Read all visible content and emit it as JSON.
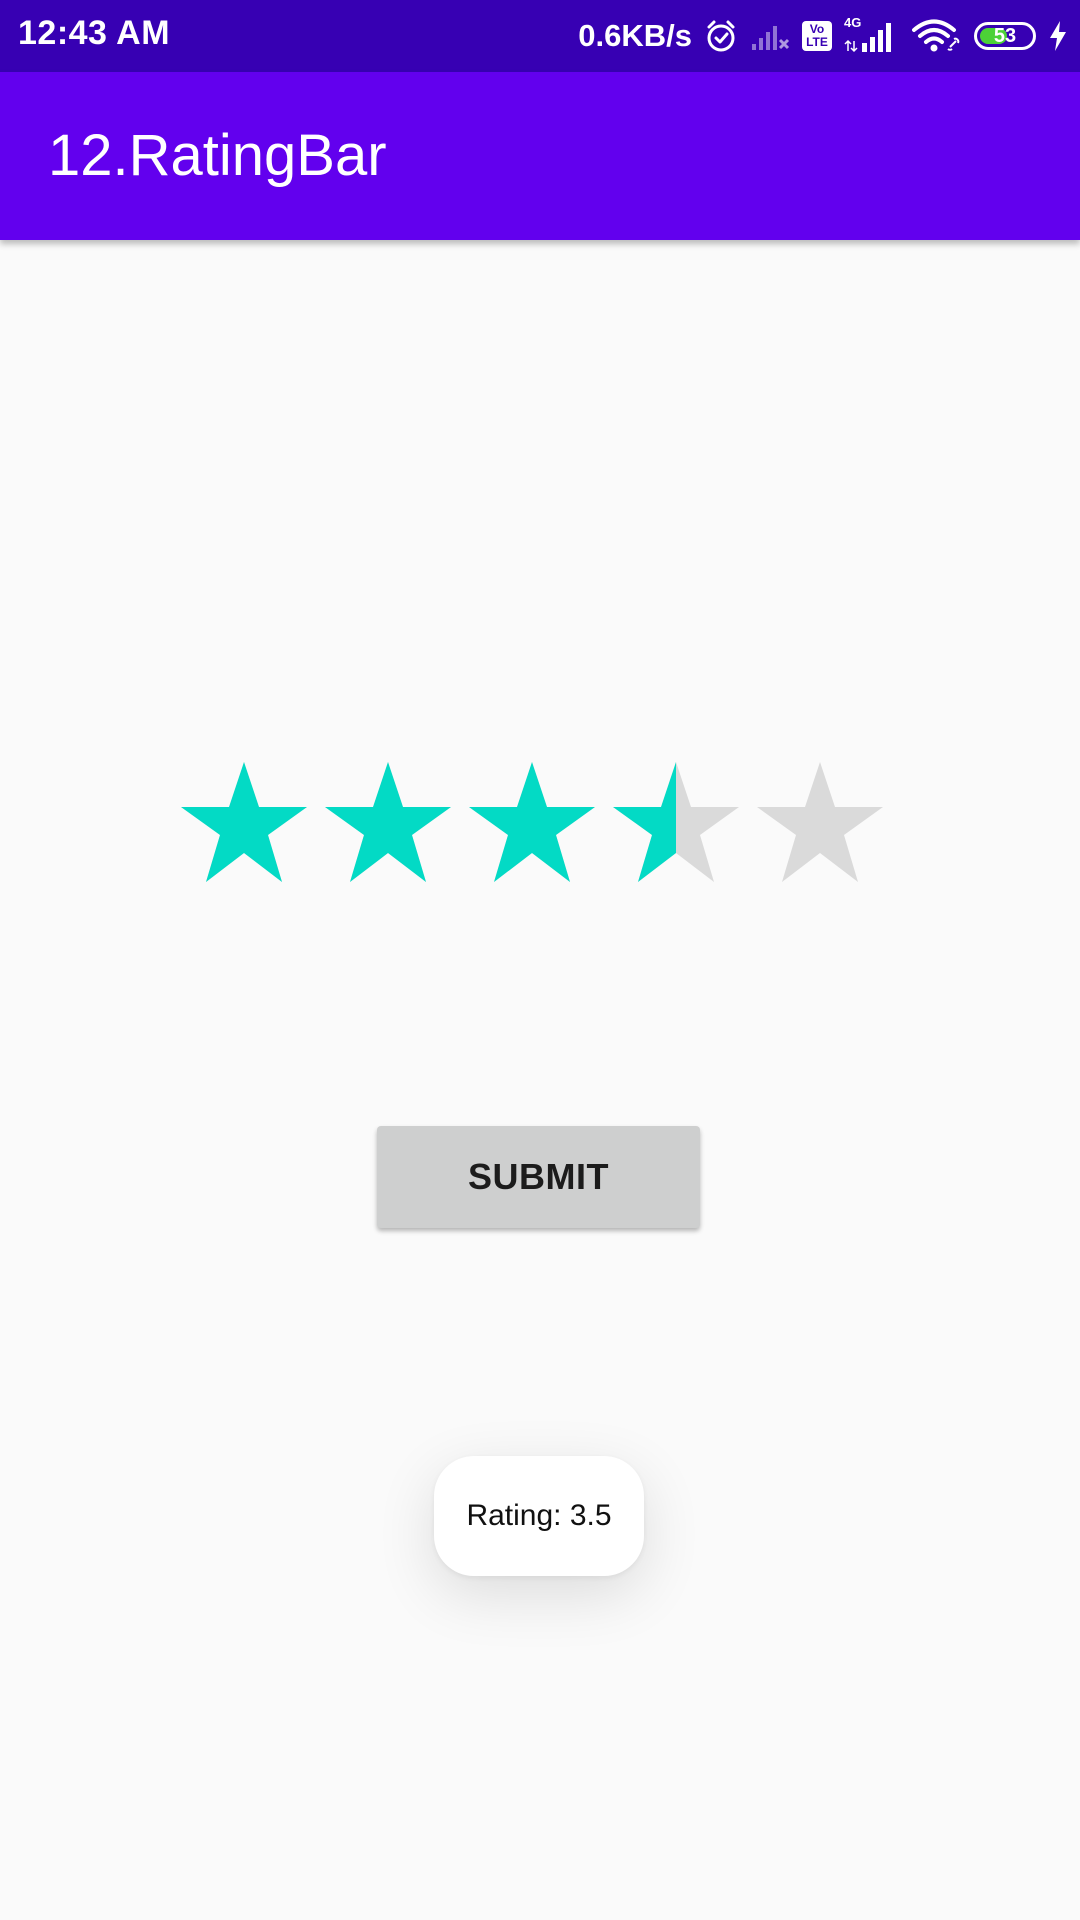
{
  "status_bar": {
    "time": "12:43 AM",
    "net_speed": "0.6KB/s",
    "icons": [
      "alarm-icon",
      "signal-no-sim-icon",
      "volte-icon",
      "4g-signal-icon",
      "wifi-icon",
      "battery-icon",
      "charging-icon"
    ],
    "volte_line1": "Vo",
    "volte_line2": "LTE",
    "network_type": "4G",
    "battery_level": "53",
    "battery_fraction": 0.53
  },
  "app_bar": {
    "title": "12.RatingBar"
  },
  "rating_bar": {
    "rating": 3.5,
    "max": 5,
    "filled_color": "#03dac5",
    "empty_color": "#dadada"
  },
  "submit_button": {
    "label": "SUBMIT"
  },
  "toast": {
    "text": "Rating: 3.5"
  },
  "colors": {
    "status_bar": "#3700b3",
    "app_bar": "#6200ee",
    "background": "#fafafa",
    "button": "#cecfcf"
  }
}
